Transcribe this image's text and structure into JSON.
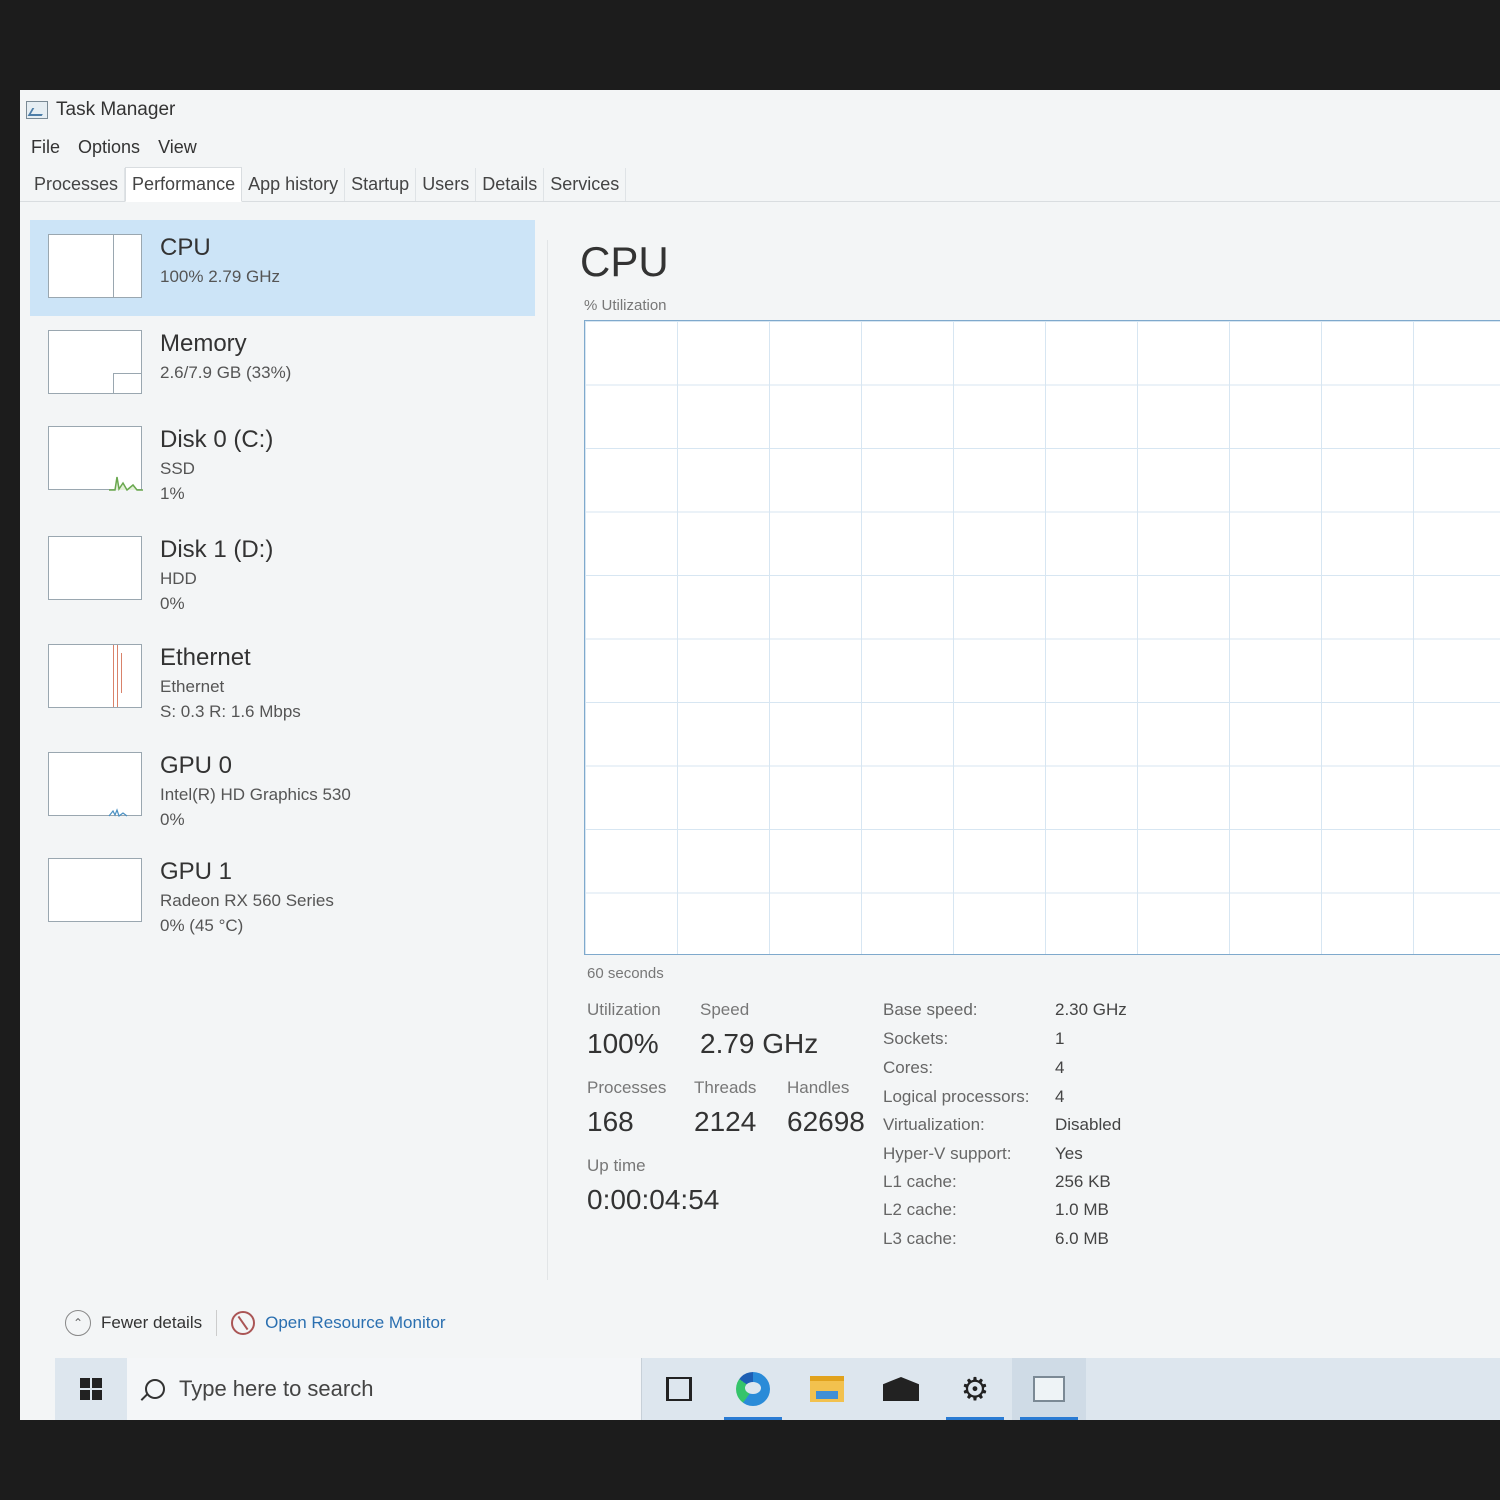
{
  "window": {
    "title": "Task Manager"
  },
  "menu": [
    "File",
    "Options",
    "View"
  ],
  "tabs": [
    "Processes",
    "Performance",
    "App history",
    "Startup",
    "Users",
    "Details",
    "Services"
  ],
  "sidebar": {
    "items": [
      {
        "title": "CPU",
        "line1": "100%  2.79 GHz",
        "line2": ""
      },
      {
        "title": "Memory",
        "line1": "2.6/7.9 GB (33%)",
        "line2": ""
      },
      {
        "title": "Disk 0 (C:)",
        "line1": "SSD",
        "line2": "1%"
      },
      {
        "title": "Disk 1 (D:)",
        "line1": "HDD",
        "line2": "0%"
      },
      {
        "title": "Ethernet",
        "line1": "Ethernet",
        "line2": "S: 0.3  R: 1.6 Mbps"
      },
      {
        "title": "GPU 0",
        "line1": "Intel(R) HD Graphics 530",
        "line2": "0%"
      },
      {
        "title": "GPU 1",
        "line1": "Radeon RX 560 Series",
        "line2": "0%  (45 °C)"
      }
    ]
  },
  "main": {
    "title": "CPU",
    "graph_label": "% Utilization",
    "time_label": "60 seconds",
    "stats": {
      "utilization_label": "Utilization",
      "utilization": "100%",
      "speed_label": "Speed",
      "speed": "2.79 GHz",
      "processes_label": "Processes",
      "processes": "168",
      "threads_label": "Threads",
      "threads": "2124",
      "handles_label": "Handles",
      "handles": "62698",
      "uptime_label": "Up time",
      "uptime": "0:00:04:54"
    },
    "specs": [
      {
        "label": "Base speed:",
        "value": "2.30 GHz"
      },
      {
        "label": "Sockets:",
        "value": "1"
      },
      {
        "label": "Cores:",
        "value": "4"
      },
      {
        "label": "Logical processors:",
        "value": "4"
      },
      {
        "label": "Virtualization:",
        "value": "Disabled"
      },
      {
        "label": "Hyper-V support:",
        "value": "Yes"
      },
      {
        "label": "L1 cache:",
        "value": "256 KB"
      },
      {
        "label": "L2 cache:",
        "value": "1.0 MB"
      },
      {
        "label": "L3 cache:",
        "value": "6.0 MB"
      }
    ]
  },
  "footer": {
    "fewer_details": "Fewer details",
    "resource_monitor": "Open Resource Monitor"
  },
  "taskbar": {
    "search_placeholder": "Type here to search",
    "icons": [
      "windows-start-icon",
      "task-view-icon",
      "edge-icon",
      "file-explorer-icon",
      "mail-icon",
      "settings-icon",
      "task-manager-icon"
    ]
  }
}
